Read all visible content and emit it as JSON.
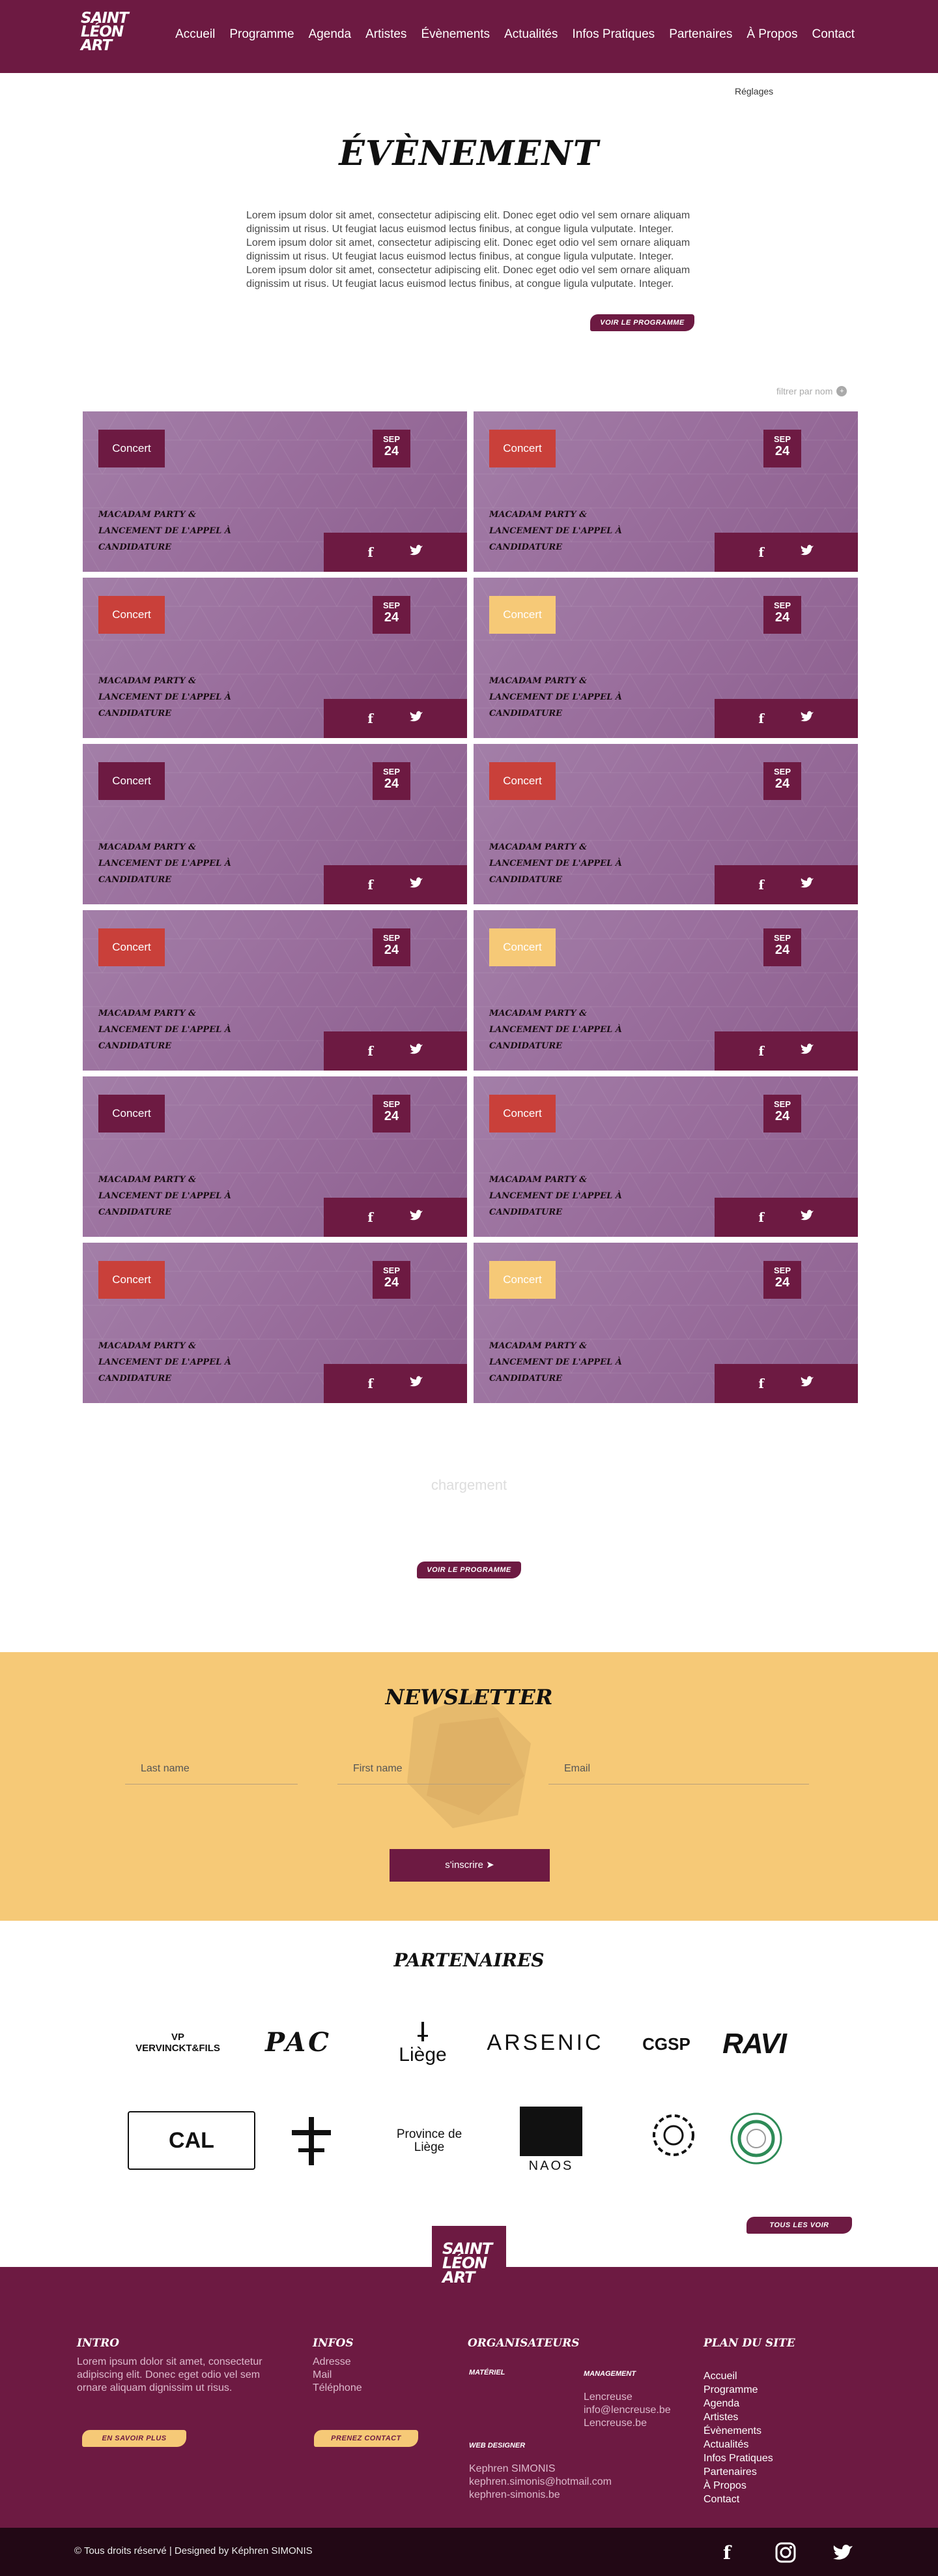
{
  "nav": {
    "logo_lines": [
      "SAINT",
      "LÉON",
      "ART"
    ],
    "items": [
      "Accueil",
      "Programme",
      "Agenda",
      "Artistes",
      "Évènements",
      "Actualités",
      "Infos Pratiques",
      "Partenaires",
      "À Propos",
      "Contact"
    ]
  },
  "settings_label": "Réglages",
  "page_title": "ÉVÈNEMENT",
  "intro_text": "Lorem ipsum dolor sit amet, consectetur adipiscing elit. Donec eget odio vel sem ornare aliquam dignissim ut risus. Ut feugiat lacus euismod lectus finibus, at congue ligula vulputate. Integer. Lorem ipsum dolor sit amet, consectetur adipiscing elit. Donec eget odio vel sem ornare aliquam dignissim ut risus. Ut feugiat lacus euismod lectus finibus, at congue ligula vulputate. Integer. Lorem ipsum dolor sit amet, consectetur adipiscing elit. Donec eget odio vel sem ornare aliquam dignissim ut risus. Ut feugiat lacus euismod lectus finibus, at congue ligula vulputate. Integer.",
  "program_button": "VOIR LE PROGRAMME",
  "filter_label": "filtrer par nom",
  "colors": {
    "brand": "#6d1a42",
    "tag_red": "#c9403a",
    "tag_purple": "#6d1a42",
    "tag_yellow": "#f6c977",
    "newsletter_bg": "#f6c977"
  },
  "events": [
    {
      "tag": "Concert",
      "tag_color": "purple",
      "month": "SEP",
      "day": "24",
      "title": "MACADAM PARTY & LANCEMENT DE L'APPEL À CANDIDATURE"
    },
    {
      "tag": "Concert",
      "tag_color": "red",
      "month": "SEP",
      "day": "24",
      "title": "MACADAM PARTY & LANCEMENT DE L'APPEL À CANDIDATURE"
    },
    {
      "tag": "Concert",
      "tag_color": "red",
      "month": "SEP",
      "day": "24",
      "title": "MACADAM PARTY & LANCEMENT DE L'APPEL À CANDIDATURE"
    },
    {
      "tag": "Concert",
      "tag_color": "yellow",
      "month": "SEP",
      "day": "24",
      "title": "MACADAM PARTY & LANCEMENT DE L'APPEL À CANDIDATURE"
    },
    {
      "tag": "Concert",
      "tag_color": "purple",
      "month": "SEP",
      "day": "24",
      "title": "MACADAM PARTY & LANCEMENT DE L'APPEL À CANDIDATURE"
    },
    {
      "tag": "Concert",
      "tag_color": "red",
      "month": "SEP",
      "day": "24",
      "title": "MACADAM PARTY & LANCEMENT DE L'APPEL À CANDIDATURE"
    },
    {
      "tag": "Concert",
      "tag_color": "red",
      "month": "SEP",
      "day": "24",
      "title": "MACADAM PARTY & LANCEMENT DE L'APPEL À CANDIDATURE"
    },
    {
      "tag": "Concert",
      "tag_color": "yellow",
      "month": "SEP",
      "day": "24",
      "title": "MACADAM PARTY & LANCEMENT DE L'APPEL À CANDIDATURE"
    },
    {
      "tag": "Concert",
      "tag_color": "purple",
      "month": "SEP",
      "day": "24",
      "title": "MACADAM PARTY & LANCEMENT DE L'APPEL À CANDIDATURE"
    },
    {
      "tag": "Concert",
      "tag_color": "red",
      "month": "SEP",
      "day": "24",
      "title": "MACADAM PARTY & LANCEMENT DE L'APPEL À CANDIDATURE"
    },
    {
      "tag": "Concert",
      "tag_color": "red",
      "month": "SEP",
      "day": "24",
      "title": "MACADAM PARTY & LANCEMENT DE L'APPEL À CANDIDATURE"
    },
    {
      "tag": "Concert",
      "tag_color": "yellow",
      "month": "SEP",
      "day": "24",
      "title": "MACADAM PARTY & LANCEMENT DE L'APPEL À CANDIDATURE"
    }
  ],
  "loading_text": "chargement",
  "newsletter": {
    "title": "NEWSLETTER",
    "last_name": "Last name",
    "first_name": "First name",
    "email": "Email",
    "submit": "s'inscrire"
  },
  "partners": {
    "title": "PARTENAIRES",
    "logos": [
      {
        "name": "vervinckt",
        "text": "VP  VERVINCKT&FILS"
      },
      {
        "name": "pac",
        "text": "PAC"
      },
      {
        "name": "liege",
        "text": "Liège"
      },
      {
        "name": "arsenic",
        "text": "ARSENIC"
      },
      {
        "name": "cgsp",
        "text": "CGSP"
      },
      {
        "name": "ravi",
        "text": "RAVI"
      },
      {
        "name": "calg",
        "text": "CAL"
      },
      {
        "name": "saint-leonard",
        "text": ""
      },
      {
        "name": "province-liege",
        "text": "Province de Liège"
      },
      {
        "name": "naos",
        "text": "NAOS"
      },
      {
        "name": "spiral",
        "text": ""
      },
      {
        "name": "green-circle",
        "text": ""
      }
    ],
    "see_all": "TOUS LES VOIR"
  },
  "footer": {
    "logo_lines": [
      "SAINT",
      "LÉON",
      "ART"
    ],
    "intro_title": "INTRO",
    "intro_text": "Lorem ipsum dolor sit amet, consectetur adipiscing elit. Donec eget odio vel sem ornare aliquam dignissim ut risus.",
    "more_button": "EN SAVOIR PLUS",
    "infos_title": "INFOS",
    "infos_items": [
      "Adresse",
      "Mail",
      "Téléphone"
    ],
    "contact_button": "PRENEZ CONTACT",
    "organizers_title": "ORGANISATEURS",
    "materiel": "MATÉRIEL",
    "management": "MANAGEMENT",
    "management_items": [
      "Lencreuse",
      "info@lencreuse.be",
      "Lencreuse.be"
    ],
    "web_designer": "WEB DESIGNER",
    "designer_items": [
      "Kephren SIMONIS",
      "kephren.simonis@hotmail.com",
      "kephren-simonis.be"
    ],
    "sitemap_title": "PLAN DU SITE",
    "sitemap_items": [
      "Accueil",
      "Programme",
      "Agenda",
      "Artistes",
      "Évènements",
      "Actualités",
      "Infos Pratiques",
      "Partenaires",
      "À Propos",
      "Contact"
    ],
    "copyright": "© Tous droits réservé | Designed by Képhren SIMONIS",
    "social": [
      "facebook-icon",
      "instagram-icon",
      "twitter-icon"
    ]
  }
}
